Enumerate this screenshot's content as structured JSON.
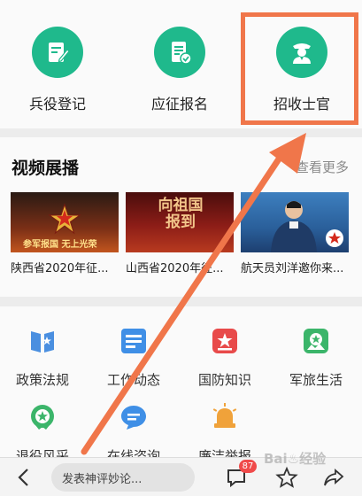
{
  "services": [
    {
      "label": "兵役登记",
      "icon": "edit-form-icon"
    },
    {
      "label": "应征报名",
      "icon": "checklist-icon"
    },
    {
      "label": "招收士官",
      "icon": "officer-avatar-icon"
    }
  ],
  "video_section": {
    "title": "视频展播",
    "see_more": "查看更多",
    "items": [
      {
        "caption": "陕西省2020年征...",
        "thumb_text": "参军报国  无上光荣"
      },
      {
        "caption": "山西省2020年征...",
        "thumb_text": "向祖国报到"
      },
      {
        "caption": "航天员刘洋邀你来...",
        "thumb_text": ""
      }
    ]
  },
  "functions": [
    {
      "label": "政策法规",
      "icon": "policy-book-icon",
      "color": "#4a8fe0"
    },
    {
      "label": "工作动态",
      "icon": "news-list-icon",
      "color": "#3f8fe6"
    },
    {
      "label": "国防知识",
      "icon": "star-shield-icon",
      "color": "#e84a4a"
    },
    {
      "label": "军旅生活",
      "icon": "camp-photo-icon",
      "color": "#3bb56a"
    },
    {
      "label": "退役风采",
      "icon": "veteran-medal-icon",
      "color": "#3bb56a"
    },
    {
      "label": "在线咨询",
      "icon": "chat-bubble-icon",
      "color": "#3f8fe6"
    },
    {
      "label": "廉洁举报",
      "icon": "alarm-light-icon",
      "color": "#f0a23a"
    }
  ],
  "bottom_bar": {
    "comment_placeholder": "发表神评妙论...",
    "comment_count": "87"
  },
  "colors": {
    "accent_green": "#1fb98c",
    "annotation_orange": "#f0764a"
  }
}
